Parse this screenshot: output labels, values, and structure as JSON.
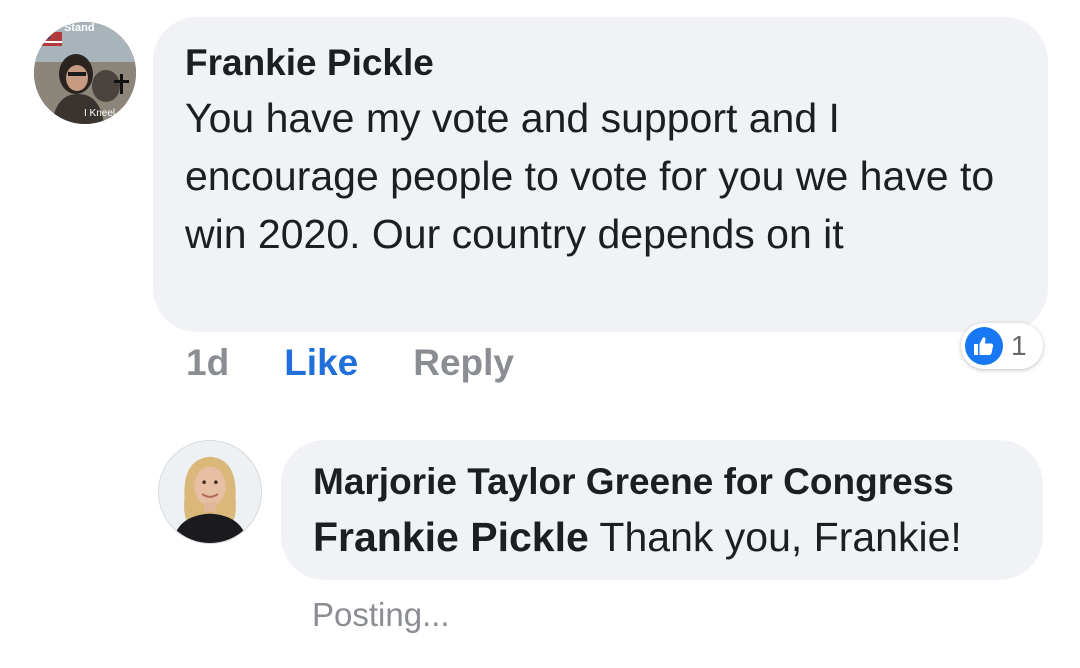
{
  "comment": {
    "author": "Frankie Pickle",
    "text": "You have my vote and support and I encourage people to vote for you we have to win 2020. Our country depends on it",
    "avatar_icon": "user-avatar-photo",
    "avatar_overlay_text_top": "Stand",
    "avatar_overlay_text_bottom": "I Kneel",
    "timestamp": "1d",
    "like_label": "Like",
    "reply_label": "Reply",
    "reactions": {
      "icon": "thumbs-up-icon",
      "count": "1",
      "color": "#1877f2"
    }
  },
  "reply": {
    "author": "Marjorie Taylor Greene for Congress",
    "mention": "Frankie Pickle",
    "text": " Thank you, Frankie!",
    "avatar_icon": "page-avatar-photo",
    "status": "Posting..."
  },
  "colors": {
    "bubble": "#f0f2f5",
    "link": "#216fdb",
    "muted": "#8a8d91"
  }
}
